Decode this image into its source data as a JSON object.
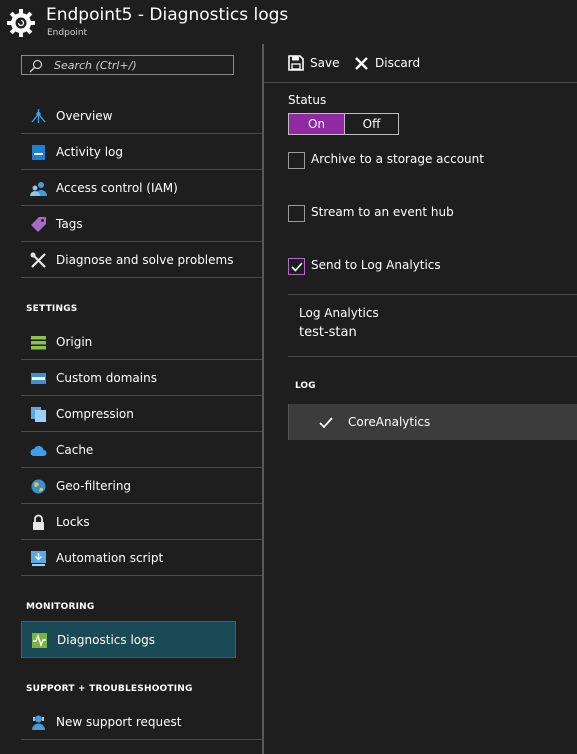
{
  "header": {
    "title": "Endpoint5 - Diagnostics logs",
    "subtitle": "Endpoint"
  },
  "search": {
    "placeholder": "Search (Ctrl+/)"
  },
  "nav": {
    "general": [
      {
        "label": "Overview",
        "icon": "overview-icon"
      },
      {
        "label": "Activity log",
        "icon": "activity-log-icon"
      },
      {
        "label": "Access control (IAM)",
        "icon": "people-icon"
      },
      {
        "label": "Tags",
        "icon": "tag-icon"
      },
      {
        "label": "Diagnose and solve problems",
        "icon": "wrench-icon"
      }
    ],
    "settings_header": "SETTINGS",
    "settings": [
      {
        "label": "Origin",
        "icon": "origin-icon"
      },
      {
        "label": "Custom domains",
        "icon": "domain-icon"
      },
      {
        "label": "Compression",
        "icon": "compression-icon"
      },
      {
        "label": "Cache",
        "icon": "cache-cloud-icon"
      },
      {
        "label": "Geo-filtering",
        "icon": "globe-icon"
      },
      {
        "label": "Locks",
        "icon": "lock-icon"
      },
      {
        "label": "Automation script",
        "icon": "download-icon"
      }
    ],
    "monitoring_header": "MONITORING",
    "monitoring": [
      {
        "label": "Diagnostics logs",
        "icon": "diagnostics-icon",
        "active": true
      }
    ],
    "support_header": "SUPPORT + TROUBLESHOOTING",
    "support": [
      {
        "label": "New support request",
        "icon": "support-person-icon"
      }
    ]
  },
  "toolbar": {
    "save_label": "Save",
    "discard_label": "Discard"
  },
  "main": {
    "status_label": "Status",
    "toggle_on": "On",
    "toggle_off": "Off",
    "archive_label": "Archive to a storage account",
    "stream_label": "Stream to an event hub",
    "send_label": "Send to Log Analytics",
    "archive_checked": false,
    "stream_checked": false,
    "send_checked": true,
    "log_analytics_label": "Log Analytics",
    "log_analytics_value": "test-stan",
    "log_header": "LOG",
    "log_items": [
      {
        "label": "CoreAnalytics",
        "checked": true
      }
    ]
  },
  "colors": {
    "accent": "#8f2aa3",
    "active_nav": "#1b4a57",
    "background": "#1e1e1e"
  }
}
